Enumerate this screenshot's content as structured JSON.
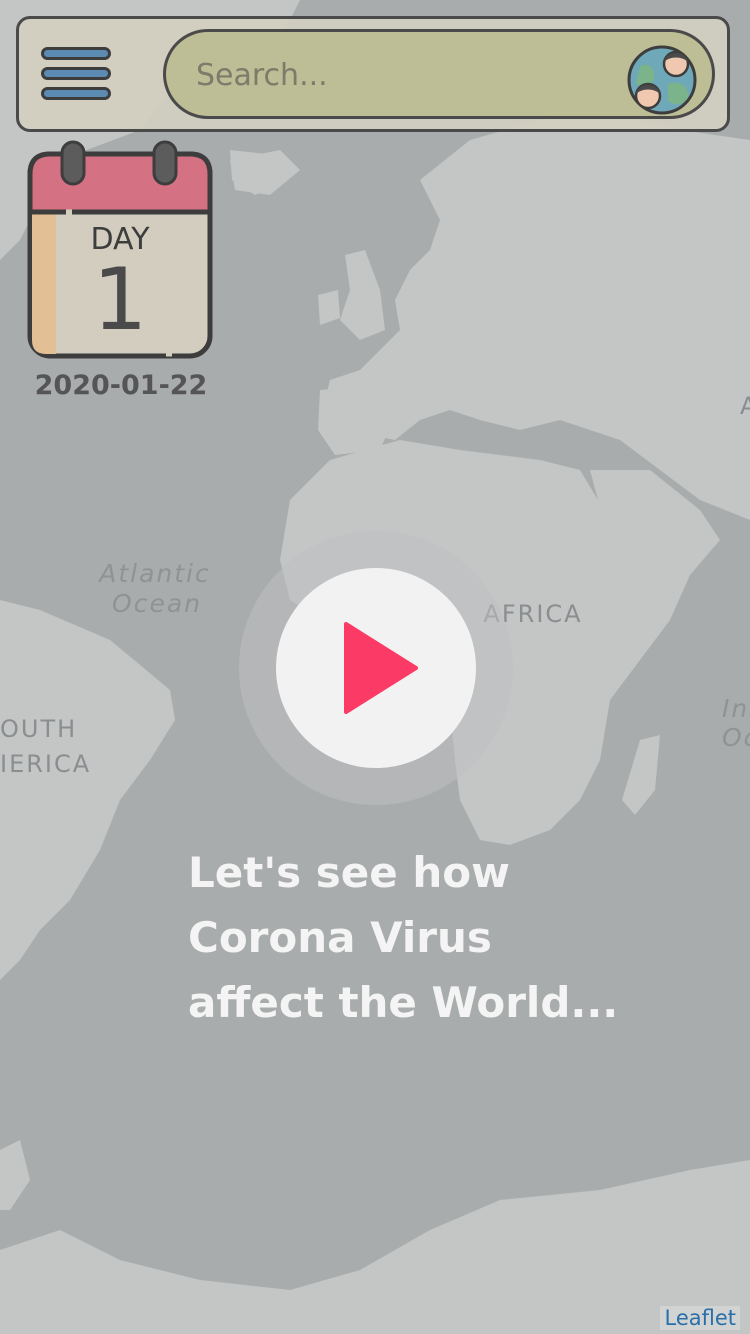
{
  "header": {
    "search": {
      "placeholder": "Search...",
      "value": ""
    }
  },
  "calendar": {
    "day_label": "DAY",
    "day_number": "1",
    "date": "2020-01-22"
  },
  "map_labels": {
    "atlantic_line1": "Atlantic",
    "atlantic_line2": "Ocean",
    "africa": "AFRICA",
    "south_america_line1": "OUTH",
    "south_america_line2": "IERICA",
    "indian_line1": "In",
    "indian_line2": "Oc",
    "asia_partial": "A"
  },
  "intro": {
    "line1": "Let's see how",
    "line2": "Corona Virus",
    "line3": "affect the World..."
  },
  "attribution": "Leaflet",
  "colors": {
    "ocean": "#a9acad",
    "land": "#c4c5c5",
    "play_icon": "#fb3b66",
    "menu_bars": "#5b8ab2",
    "calendar_top": "#d47182",
    "search_bg": "#bdbd96"
  }
}
